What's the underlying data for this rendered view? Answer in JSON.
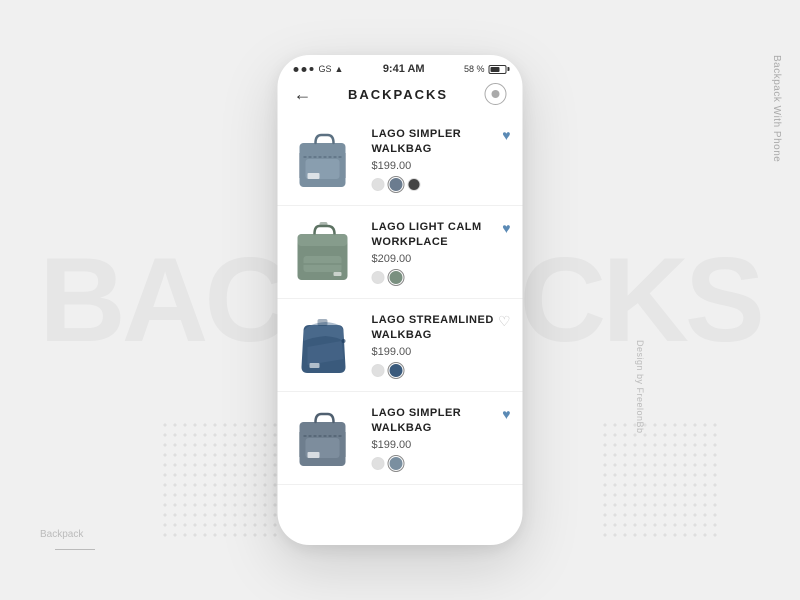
{
  "background": {
    "text": "BACKPACKS"
  },
  "side_labels": {
    "right": "Backpack With Phone",
    "design": "Design by FreelonBb",
    "bottom_left": "Backpack"
  },
  "status_bar": {
    "time": "9:41 AM",
    "battery": "58 %",
    "carrier": "GS"
  },
  "nav": {
    "title": "BACKPACKS",
    "back_label": "←",
    "profile_label": "profile"
  },
  "products": [
    {
      "id": 1,
      "name": "LAGO SIMPLER\nWALKBAG",
      "price": "$199.00",
      "liked": true,
      "colors": [
        "#e0e0e0",
        "#6b7c8f",
        "#444"
      ],
      "selected_color": 1,
      "bag_color": "#7a8fa0",
      "bag_style": "walkbag"
    },
    {
      "id": 2,
      "name": "LAGO LIGHT CALM\nWORKPLACE",
      "price": "$209.00",
      "liked": true,
      "colors": [
        "#e0e0e0",
        "#7a9080"
      ],
      "selected_color": 1,
      "bag_color": "#7a9080",
      "bag_style": "workplace"
    },
    {
      "id": 3,
      "name": "LAGO STREAMLINED\nWALKBAG",
      "price": "$199.00",
      "liked": false,
      "colors": [
        "#e0e0e0",
        "#3a5a7c"
      ],
      "selected_color": 1,
      "bag_color": "#3a5a7c",
      "bag_style": "streamlined"
    },
    {
      "id": 4,
      "name": "LAGO SIMPLER\nWALKBAG",
      "price": "$199.00",
      "liked": true,
      "colors": [
        "#e0e0e0",
        "#7a8fa0"
      ],
      "selected_color": 1,
      "bag_color": "#6e7e8e",
      "bag_style": "walkbag2"
    }
  ]
}
